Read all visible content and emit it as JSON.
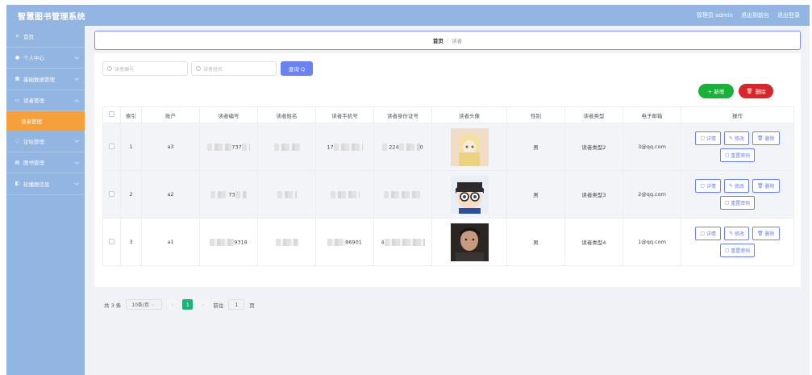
{
  "header": {
    "title": "智慧图书管理系统",
    "admin": "管理员 admin",
    "to_front": "退出到前台",
    "logout": "退出登录"
  },
  "sidebar": {
    "items": [
      {
        "label": "首页",
        "icon": "home-icon"
      },
      {
        "label": "个人中心",
        "icon": "user-icon"
      },
      {
        "label": "基础数据管理",
        "icon": "grid-icon"
      },
      {
        "label": "读者管理",
        "icon": "id-card-icon"
      },
      {
        "label": "读者管理",
        "icon": ""
      },
      {
        "label": "论坛管理",
        "icon": "chat-icon"
      },
      {
        "label": "图书管理",
        "icon": "book-icon"
      },
      {
        "label": "轮播图信息",
        "icon": "image-icon"
      }
    ]
  },
  "breadcrumb": {
    "home": "首页",
    "sep": "/",
    "current": "读者"
  },
  "search": {
    "no_placeholder": "读者编号",
    "name_placeholder": "读者姓名",
    "query": "查询 Q"
  },
  "actions": {
    "add": "+ 新增",
    "delete": "删除"
  },
  "table": {
    "headers": [
      "",
      "索引",
      "账户",
      "读者编号",
      "读者姓名",
      "读者手机号",
      "读者身份证号",
      "读者头像",
      "性别",
      "读者类型",
      "电子邮箱",
      "操作"
    ],
    "rows": [
      {
        "index": "1",
        "account": "a3",
        "no": "737",
        "phone": "17",
        "id": "224",
        "id2": "0",
        "gender": "男",
        "type": "读者类型2",
        "email": "3@qq.com"
      },
      {
        "index": "2",
        "account": "a2",
        "no": "73",
        "phone": "",
        "id": "",
        "id2": "",
        "gender": "男",
        "type": "读者类型3",
        "email": "2@qq.com"
      },
      {
        "index": "3",
        "account": "a1",
        "no": "9318",
        "phone": "86901",
        "id": "4",
        "id2": "",
        "gender": "男",
        "type": "读者类型4",
        "email": "1@qq.com"
      }
    ],
    "op_labels": {
      "detail": "详情",
      "edit": "修改",
      "del": "删除",
      "reset": "重置密码"
    }
  },
  "pager": {
    "total": "共 3 条",
    "size": "10条/页",
    "page": "1",
    "goto": "前往",
    "goto_val": "1",
    "unit": "页"
  }
}
